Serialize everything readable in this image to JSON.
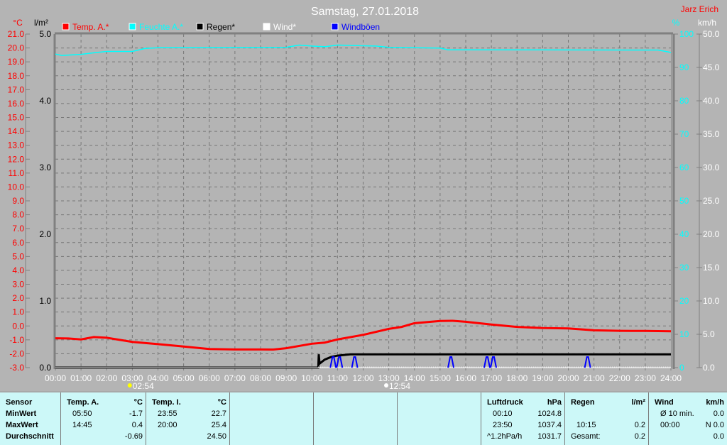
{
  "title": "Samstag, 27.01.2018",
  "station": "Jarz Erich",
  "colors": {
    "temp": "#ff0000",
    "humidity": "#00ffff",
    "rain": "#000000",
    "wind": "#ffffff",
    "gust": "#0000ff",
    "background": "#b4b4b4",
    "table": "#ccf8f8"
  },
  "chart_data": {
    "type": "line",
    "title": "Samstag, 27.01.2018",
    "legend": [
      "Temp. A.*",
      "Feuchte A.*",
      "Regen*",
      "Wind*",
      "Windböen"
    ],
    "legend_placement": "top",
    "grid": true,
    "x_ticks": [
      "00:00",
      "01:00",
      "02:00",
      "03:00",
      "04:00",
      "05:00",
      "06:00",
      "07:00",
      "08:00",
      "09:00",
      "10:00",
      "11:00",
      "12:00",
      "13:00",
      "14:00",
      "15:00",
      "16:00",
      "17:00",
      "18:00",
      "19:00",
      "20:00",
      "21:00",
      "22:00",
      "23:00",
      "24:00"
    ],
    "x_range_hours": [
      0,
      24
    ],
    "axes": {
      "temp": {
        "unit": "°C",
        "range": [
          -3,
          21
        ],
        "ticks": [
          "21.0",
          "20.0",
          "19.0",
          "18.0",
          "17.0",
          "16.0",
          "15.0",
          "14.0",
          "13.0",
          "12.0",
          "11.0",
          "10.0",
          "9.0",
          "8.0",
          "7.0",
          "6.0",
          "5.0",
          "4.0",
          "3.0",
          "2.0",
          "1.0",
          "0.0",
          "-1.0",
          "-2.0",
          "-3.0"
        ]
      },
      "rain": {
        "unit": "l/m²",
        "range": [
          0,
          5
        ],
        "ticks": [
          "5.0",
          "4.0",
          "3.0",
          "2.0",
          "1.0",
          "0.0"
        ]
      },
      "humidity": {
        "unit": "%",
        "range": [
          0,
          100
        ],
        "ticks": [
          "100",
          "90",
          "80",
          "70",
          "60",
          "50",
          "40",
          "30",
          "20",
          "10",
          "0"
        ]
      },
      "wind": {
        "unit": "km/h",
        "range": [
          0,
          50
        ],
        "ticks": [
          "50.0",
          "45.0",
          "40.0",
          "35.0",
          "30.0",
          "25.0",
          "20.0",
          "15.0",
          "10.0",
          "5.0",
          "0.0"
        ]
      }
    },
    "series": [
      {
        "name": "Temp. A.*",
        "axis": "temp",
        "x": [
          0,
          0.5,
          1,
          1.5,
          2,
          3,
          4,
          5,
          6,
          7,
          8,
          8.5,
          9,
          10,
          10.5,
          11,
          12,
          13,
          13.5,
          14,
          15,
          15.5,
          16,
          17,
          18,
          19,
          20,
          21,
          22,
          23,
          24
        ],
        "y": [
          -0.89,
          -0.9,
          -0.97,
          -0.8,
          -0.85,
          -1.15,
          -1.31,
          -1.48,
          -1.66,
          -1.69,
          -1.69,
          -1.7,
          -1.6,
          -1.28,
          -1.2,
          -0.97,
          -0.64,
          -0.21,
          -0.07,
          0.2,
          0.36,
          0.37,
          0.3,
          0.1,
          -0.07,
          -0.15,
          -0.18,
          -0.31,
          -0.35,
          -0.36,
          -0.38
        ]
      },
      {
        "name": "Feuchte A.*",
        "axis": "humidity",
        "x": [
          0,
          0.25,
          1,
          1.5,
          2,
          3,
          3.5,
          4,
          9,
          9.5,
          10,
          10.5,
          11,
          12,
          12.5,
          13,
          15,
          15.3,
          23.5,
          24
        ],
        "y": [
          94.0,
          93.6,
          93.9,
          94.4,
          94.8,
          94.8,
          95.7,
          95.9,
          96.0,
          96.7,
          96.4,
          96.2,
          96.7,
          96.5,
          96.4,
          96.0,
          95.8,
          95.3,
          95.2,
          94.5
        ]
      },
      {
        "name": "Regen*",
        "axis": "rain",
        "x": [
          0,
          10.25,
          10.27,
          10.3,
          10.5,
          10.75,
          11,
          11.5,
          24
        ],
        "y": [
          0,
          0,
          0.2,
          0.06,
          0.12,
          0.16,
          0.18,
          0.2,
          0.2
        ]
      },
      {
        "name": "Wind*",
        "axis": "wind",
        "x": [
          0,
          24
        ],
        "y": [
          0,
          0
        ]
      },
      {
        "name": "Windböen",
        "axis": "wind",
        "peaks_at_hours": [
          10.83,
          11.08,
          11.67,
          15.42,
          16.83,
          17.08,
          20.75
        ],
        "peak_value": 1.6
      }
    ],
    "annotations": [
      {
        "text": "02:54",
        "icon": "sunrise-icon"
      },
      {
        "text": "12:54",
        "icon": "moon-icon"
      }
    ]
  },
  "table": {
    "sensor": {
      "header": "Sensor",
      "rows": [
        "MinWert",
        "MaxWert",
        "Durchschnitt"
      ]
    },
    "columns": [
      {
        "name": "Temp. A.",
        "unit": "°C",
        "min_time": "05:50",
        "min": "-1.7",
        "max_time": "14:45",
        "max": "0.4",
        "avg_label": "",
        "avg": "-0.69"
      },
      {
        "name": "Temp. I.",
        "unit": "°C",
        "min_time": "23:55",
        "min": "22.7",
        "max_time": "20:00",
        "max": "25.4",
        "avg_label": "",
        "avg": "24.50"
      },
      {
        "name": "",
        "unit": "",
        "min_time": "",
        "min": "",
        "max_time": "",
        "max": "",
        "avg_label": "",
        "avg": ""
      },
      {
        "name": "",
        "unit": "",
        "min_time": "",
        "min": "",
        "max_time": "",
        "max": "",
        "avg_label": "",
        "avg": ""
      },
      {
        "name": "",
        "unit": "",
        "min_time": "",
        "min": "",
        "max_time": "",
        "max": "",
        "avg_label": "",
        "avg": ""
      },
      {
        "name": "Luftdruck",
        "unit": "hPa",
        "min_time": "00:10",
        "min": "1024.8",
        "max_time": "23:50",
        "max": "1037.4",
        "avg_label": "^1.2hPa/h",
        "avg": "1031.7"
      },
      {
        "name": "Regen",
        "unit": "l/m²",
        "min_time": "",
        "min": "",
        "max_time": "10:15",
        "max": "0.2",
        "avg_label": "Gesamt:",
        "avg": "0.2"
      },
      {
        "name": "Wind",
        "unit": "km/h",
        "min_time": "Ø 10 min.",
        "min": "0.0",
        "max_time": "00:00",
        "max": "N 0.0",
        "avg_label": "",
        "avg": "0.0"
      }
    ]
  }
}
